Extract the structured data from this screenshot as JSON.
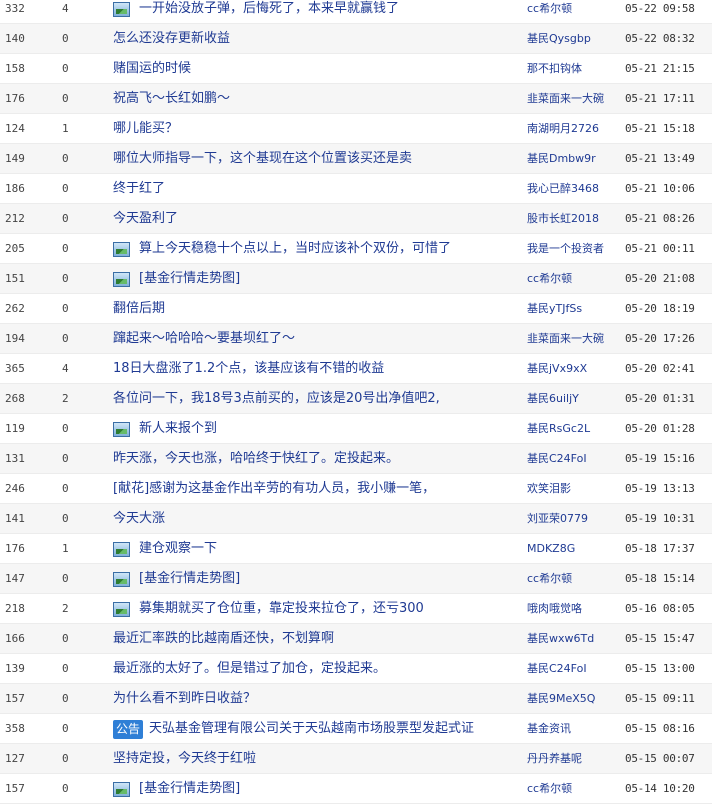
{
  "posts": [
    {
      "reads": "332",
      "replies": "4",
      "icon": "image-icon",
      "title": "一开始没放子弹，后悔死了，本来早就赢钱了",
      "author": "cc希尔顿",
      "time": "05-22 09:58"
    },
    {
      "reads": "140",
      "replies": "0",
      "title": "怎么还没存更新收益",
      "author": "基民Qysgbp",
      "time": "05-22 08:32"
    },
    {
      "reads": "158",
      "replies": "0",
      "title": "赌国运的时候",
      "author": "那不扣钩体",
      "time": "05-21 21:15"
    },
    {
      "reads": "176",
      "replies": "0",
      "title": "祝高飞～长红如鹏～",
      "author": "韭菜面来一大碗",
      "time": "05-21 17:11"
    },
    {
      "reads": "124",
      "replies": "1",
      "title": "哪儿能买？",
      "author": "南湖明月2726",
      "time": "05-21 15:18"
    },
    {
      "reads": "149",
      "replies": "0",
      "title": "哪位大师指导一下，这个基现在这个位置该买还是卖",
      "author": "基民Dmbw9r",
      "time": "05-21 13:49"
    },
    {
      "reads": "186",
      "replies": "0",
      "title": "终于红了",
      "author": "我心已醉3468",
      "time": "05-21 10:06"
    },
    {
      "reads": "212",
      "replies": "0",
      "title": "今天盈利了",
      "author": "股市长虹2018",
      "time": "05-21 08:26"
    },
    {
      "reads": "205",
      "replies": "0",
      "icon": "image-icon",
      "title": "算上今天稳稳十个点以上，当时应该补个双份，可惜了",
      "author": "我是一个投资者",
      "time": "05-21 00:11"
    },
    {
      "reads": "151",
      "replies": "0",
      "icon": "image-icon",
      "title": "[基金行情走势图]",
      "author": "cc希尔顿",
      "time": "05-20 21:08"
    },
    {
      "reads": "262",
      "replies": "0",
      "title": "翻倍后期",
      "author": "基民yTJfSs",
      "time": "05-20 18:19"
    },
    {
      "reads": "194",
      "replies": "0",
      "title": "蹿起来～哈哈哈～要基坝红了～",
      "author": "韭菜面来一大碗",
      "time": "05-20 17:26"
    },
    {
      "reads": "365",
      "replies": "4",
      "title": "18日大盘涨了1.2个点，该基应该有不错的收益",
      "author": "基民jVx9xX",
      "time": "05-20 02:41"
    },
    {
      "reads": "268",
      "replies": "2",
      "title": "各位问一下，我18号3点前买的，应该是20号出净值吧2,",
      "author": "基民6uiljY",
      "time": "05-20 01:31"
    },
    {
      "reads": "119",
      "replies": "0",
      "icon": "image-icon",
      "title": "新人来报个到",
      "author": "基民RsGc2L",
      "time": "05-20 01:28"
    },
    {
      "reads": "131",
      "replies": "0",
      "title": "昨天涨，今天也涨，哈哈终于快红了。定投起来。",
      "author": "基民C24FoI",
      "time": "05-19 15:16"
    },
    {
      "reads": "246",
      "replies": "0",
      "title": "[献花]感谢为这基金作出辛劳的有功人员，我小赚一笔，",
      "author": "欢笑泪影",
      "time": "05-19 13:13"
    },
    {
      "reads": "141",
      "replies": "0",
      "title": "今天大涨",
      "author": "刘亚荣0779",
      "time": "05-19 10:31"
    },
    {
      "reads": "176",
      "replies": "1",
      "icon": "image-icon",
      "title": "建仓观察一下",
      "author": "MDKZ8G",
      "time": "05-18 17:37"
    },
    {
      "reads": "147",
      "replies": "0",
      "icon": "image-icon",
      "title": "[基金行情走势图]",
      "author": "cc希尔顿",
      "time": "05-18 15:14"
    },
    {
      "reads": "218",
      "replies": "2",
      "icon": "image-icon",
      "title": "募集期就买了仓位重，靠定投来拉仓了，还亏300",
      "author": "哦肉哦觉咯",
      "time": "05-16 08:05"
    },
    {
      "reads": "166",
      "replies": "0",
      "title": "最近汇率跌的比越南盾还快，不划算啊",
      "author": "基民wxw6Td",
      "time": "05-15 15:47"
    },
    {
      "reads": "139",
      "replies": "0",
      "title": "最近涨的太好了。但是错过了加仓，定投起来。",
      "author": "基民C24FoI",
      "time": "05-15 13:00"
    },
    {
      "reads": "157",
      "replies": "0",
      "title": "为什么看不到昨日收益？",
      "author": "基民9MeX5Q",
      "time": "05-15 09:11"
    },
    {
      "reads": "358",
      "replies": "0",
      "badge": "公告",
      "title": "天弘基金管理有限公司关于天弘越南市场股票型发起式证",
      "author": "基金资讯",
      "time": "05-15 08:16"
    },
    {
      "reads": "127",
      "replies": "0",
      "title": "坚持定投，今天终于红啦",
      "author": "丹丹养基呢",
      "time": "05-15 00:07"
    },
    {
      "reads": "157",
      "replies": "0",
      "icon": "image-icon",
      "title": "[基金行情走势图]",
      "author": "cc希尔顿",
      "time": "05-14 10:20"
    }
  ]
}
